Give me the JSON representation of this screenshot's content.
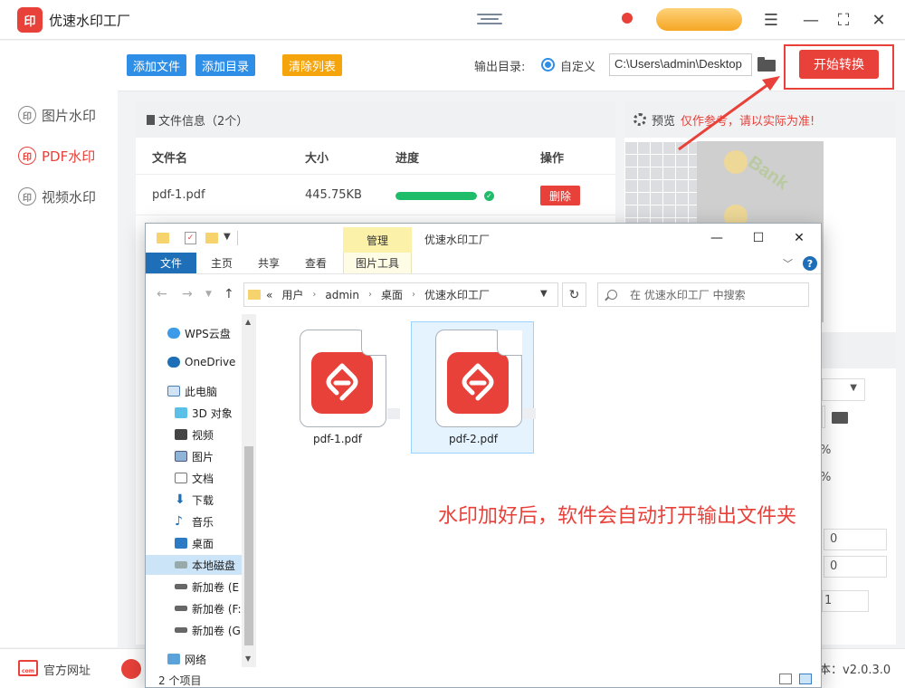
{
  "app": {
    "logo_text": "印",
    "title": "优速水印工厂",
    "version": "本：v2.0.3.0"
  },
  "sidebar": {
    "items": [
      {
        "label": "图片水印",
        "icon": "印"
      },
      {
        "label": "PDF水印",
        "icon": "印"
      },
      {
        "label": "视频水印",
        "icon": "印"
      }
    ]
  },
  "toolbar": {
    "add_file": "添加文件",
    "add_dir": "添加目录",
    "clear_list": "清除列表",
    "output_label": "输出目录:",
    "radio_label": "自定义",
    "output_path": "C:\\Users\\admin\\Desktop",
    "start_button": "开始转换"
  },
  "file_panel": {
    "header": "文件信息（2个）",
    "columns": [
      "文件名",
      "大小",
      "进度",
      "操作"
    ],
    "rows": [
      {
        "name": "pdf-1.pdf",
        "size": "445.75KB",
        "progress": 1.0,
        "action": "删除"
      }
    ]
  },
  "preview": {
    "label": "预览",
    "warning": "仅作参考，请以实际为准!",
    "watermark_text": "Bank"
  },
  "settings_values": {
    "pct1": "%",
    "pct2": "%",
    "num1": "0",
    "num2": "0",
    "num3": "1"
  },
  "footer": {
    "site": "官方网址"
  },
  "explorer": {
    "manage_tab": "管理",
    "window_title": "优速水印工厂",
    "ribbon_tabs": [
      "文件",
      "主页",
      "共享",
      "查看",
      "图片工具"
    ],
    "breadcrumb": [
      "用户",
      "admin",
      "桌面",
      "优速水印工厂"
    ],
    "breadcrumb_prefix": "«",
    "search_placeholder": "在 优速水印工厂 中搜索",
    "nav_items": [
      {
        "label": "WPS云盘",
        "icon": "cloud-icon"
      },
      {
        "label": "OneDrive",
        "icon": "onedrive-icon"
      },
      {
        "label": "此电脑",
        "icon": "computer-icon"
      },
      {
        "label": "3D 对象",
        "icon": "cube-icon"
      },
      {
        "label": "视频",
        "icon": "video-icon"
      },
      {
        "label": "图片",
        "icon": "picture-icon"
      },
      {
        "label": "文档",
        "icon": "document-icon"
      },
      {
        "label": "下载",
        "icon": "download-icon"
      },
      {
        "label": "音乐",
        "icon": "music-icon"
      },
      {
        "label": "桌面",
        "icon": "desktop-icon"
      },
      {
        "label": "本地磁盘",
        "icon": "drive-icon"
      },
      {
        "label": "新加卷 (E",
        "icon": "drive-icon"
      },
      {
        "label": "新加卷 (F:",
        "icon": "drive-icon"
      },
      {
        "label": "新加卷 (G",
        "icon": "drive-icon"
      },
      {
        "label": "网络",
        "icon": "network-icon"
      }
    ],
    "files": [
      {
        "name": "pdf-1.pdf"
      },
      {
        "name": "pdf-2.pdf"
      }
    ],
    "annotation": "水印加好后，软件会自动打开输出文件夹",
    "status": "2 个项目"
  },
  "colors": {
    "accent_red": "#e8413a",
    "button_blue": "#2f8fe6",
    "button_orange": "#f5a40c",
    "progress_green": "#1fbd6a"
  }
}
